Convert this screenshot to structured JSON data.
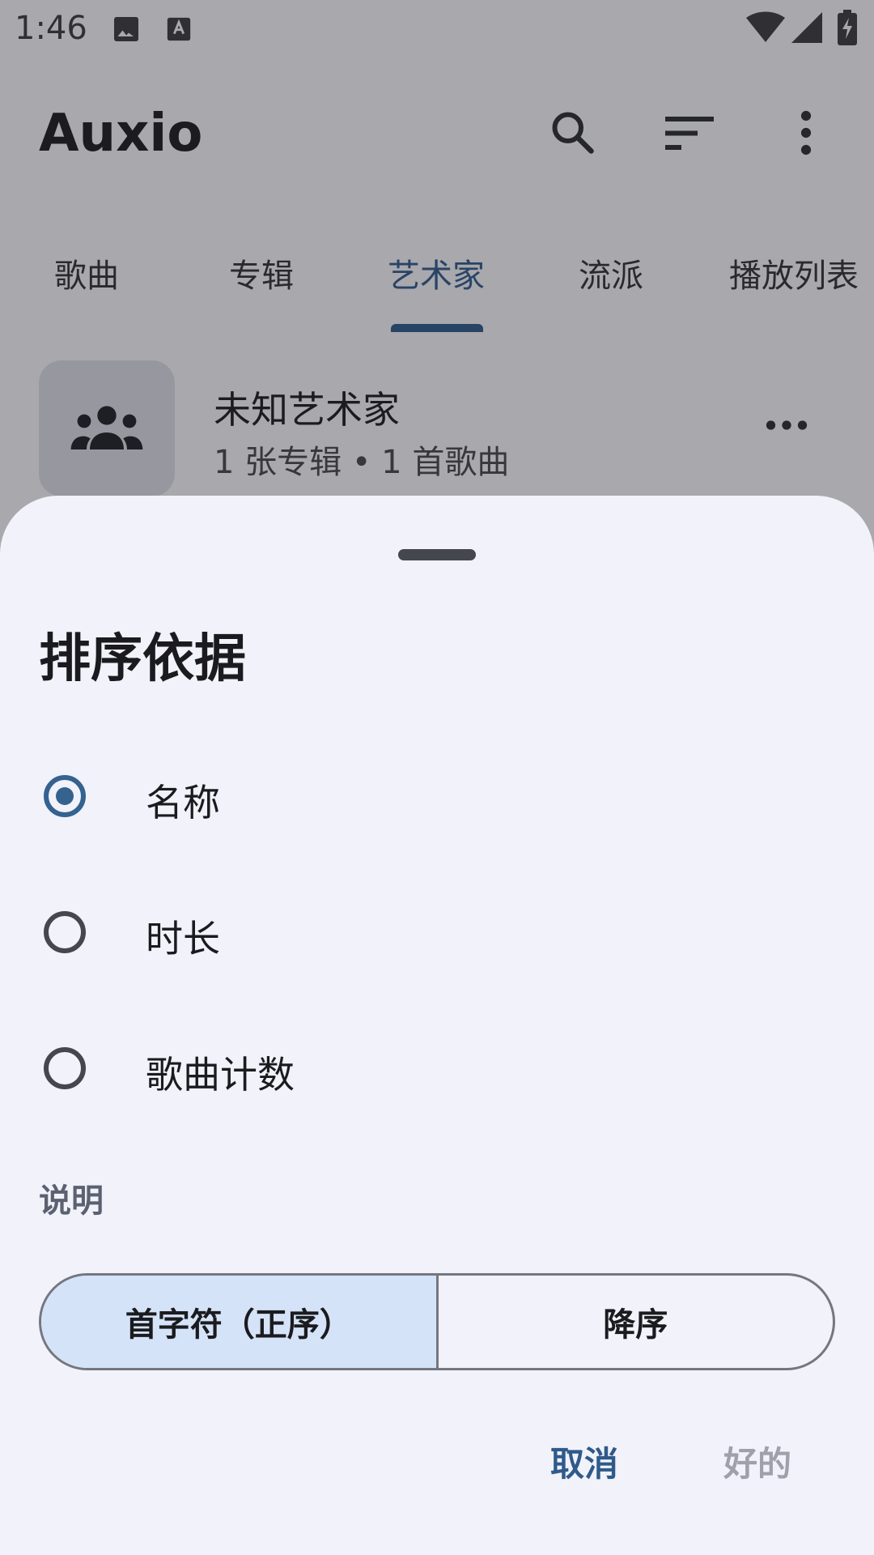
{
  "status_bar": {
    "time": "1:46",
    "icons": [
      "image-icon",
      "font-icon",
      "wifi-icon",
      "signal-icon",
      "battery-icon"
    ]
  },
  "app_bar": {
    "title": "Auxio",
    "actions": [
      "search-icon",
      "sort-icon",
      "more-vert-icon"
    ]
  },
  "tabs": [
    {
      "label": "歌曲",
      "active": false
    },
    {
      "label": "专辑",
      "active": false
    },
    {
      "label": "艺术家",
      "active": true
    },
    {
      "label": "流派",
      "active": false
    },
    {
      "label": "播放列表",
      "active": false
    }
  ],
  "artist_row": {
    "name": "未知艺术家",
    "meta": "1 张专辑 • 1 首歌曲",
    "icon": "group-icon"
  },
  "sort_sheet": {
    "title": "排序依据",
    "options": [
      {
        "label": "名称",
        "checked": true
      },
      {
        "label": "时长",
        "checked": false
      },
      {
        "label": "歌曲计数",
        "checked": false
      }
    ],
    "direction_label": "说明",
    "directions": [
      {
        "label": "首字符（正序）",
        "selected": true
      },
      {
        "label": "降序",
        "selected": false
      }
    ],
    "cancel_label": "取消",
    "ok_label": "好的"
  },
  "colors": {
    "accent": "#2f5a8a",
    "sheet_bg": "#f1f2fa",
    "segment_selected": "#d5e3f8"
  }
}
